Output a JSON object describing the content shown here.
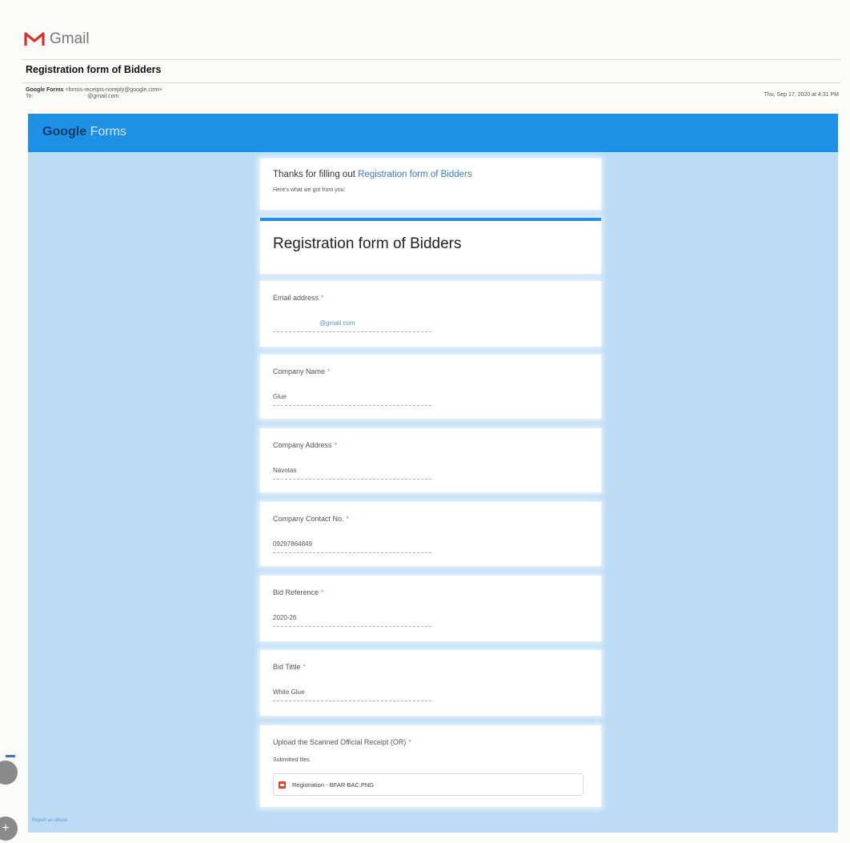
{
  "app": {
    "name": "Gmail"
  },
  "email": {
    "subject": "Registration form of Bidders",
    "from_name": "Google Forms",
    "from_address": "<forms-receipts-noreply@google.com>",
    "to_label": "To:",
    "to_value": "@gmail.com",
    "date": "Thu, Sep 17, 2020 at 4:31 PM"
  },
  "google_forms": {
    "logo_google": "Google",
    "logo_forms": "Forms",
    "thanks_prefix": "Thanks for filling out",
    "thanks_link": "Registration form of Bidders",
    "got_text": "Here's what we got from you:",
    "form_title": "Registration form of Bidders",
    "required_mark": "*",
    "questions": [
      {
        "label": "Email address",
        "answer": "@gmail.com"
      },
      {
        "label": "Company Name",
        "answer": "Glue"
      },
      {
        "label": "Company Address",
        "answer": "Navotas"
      },
      {
        "label": "Company Contact No.",
        "answer": "09297864849"
      },
      {
        "label": "Bid Reference",
        "answer": "2020-26"
      },
      {
        "label": "Bid Tittle",
        "answer": "White Glue"
      }
    ],
    "upload": {
      "label": "Upload the Scanned Official Receipt (OR)",
      "submitted_label": "Submitted files",
      "file_name": "Registration - BFAR BAC.PNG"
    },
    "report_link": "Report an abuse"
  },
  "side_buttons": {
    "top_glyph": "",
    "bottom_glyph": "+"
  },
  "colors": {
    "gf_bar": "#1e90e6",
    "gf_background": "#bcdcf6",
    "link": "#3d78c9",
    "gmail_red": "#d93025"
  }
}
